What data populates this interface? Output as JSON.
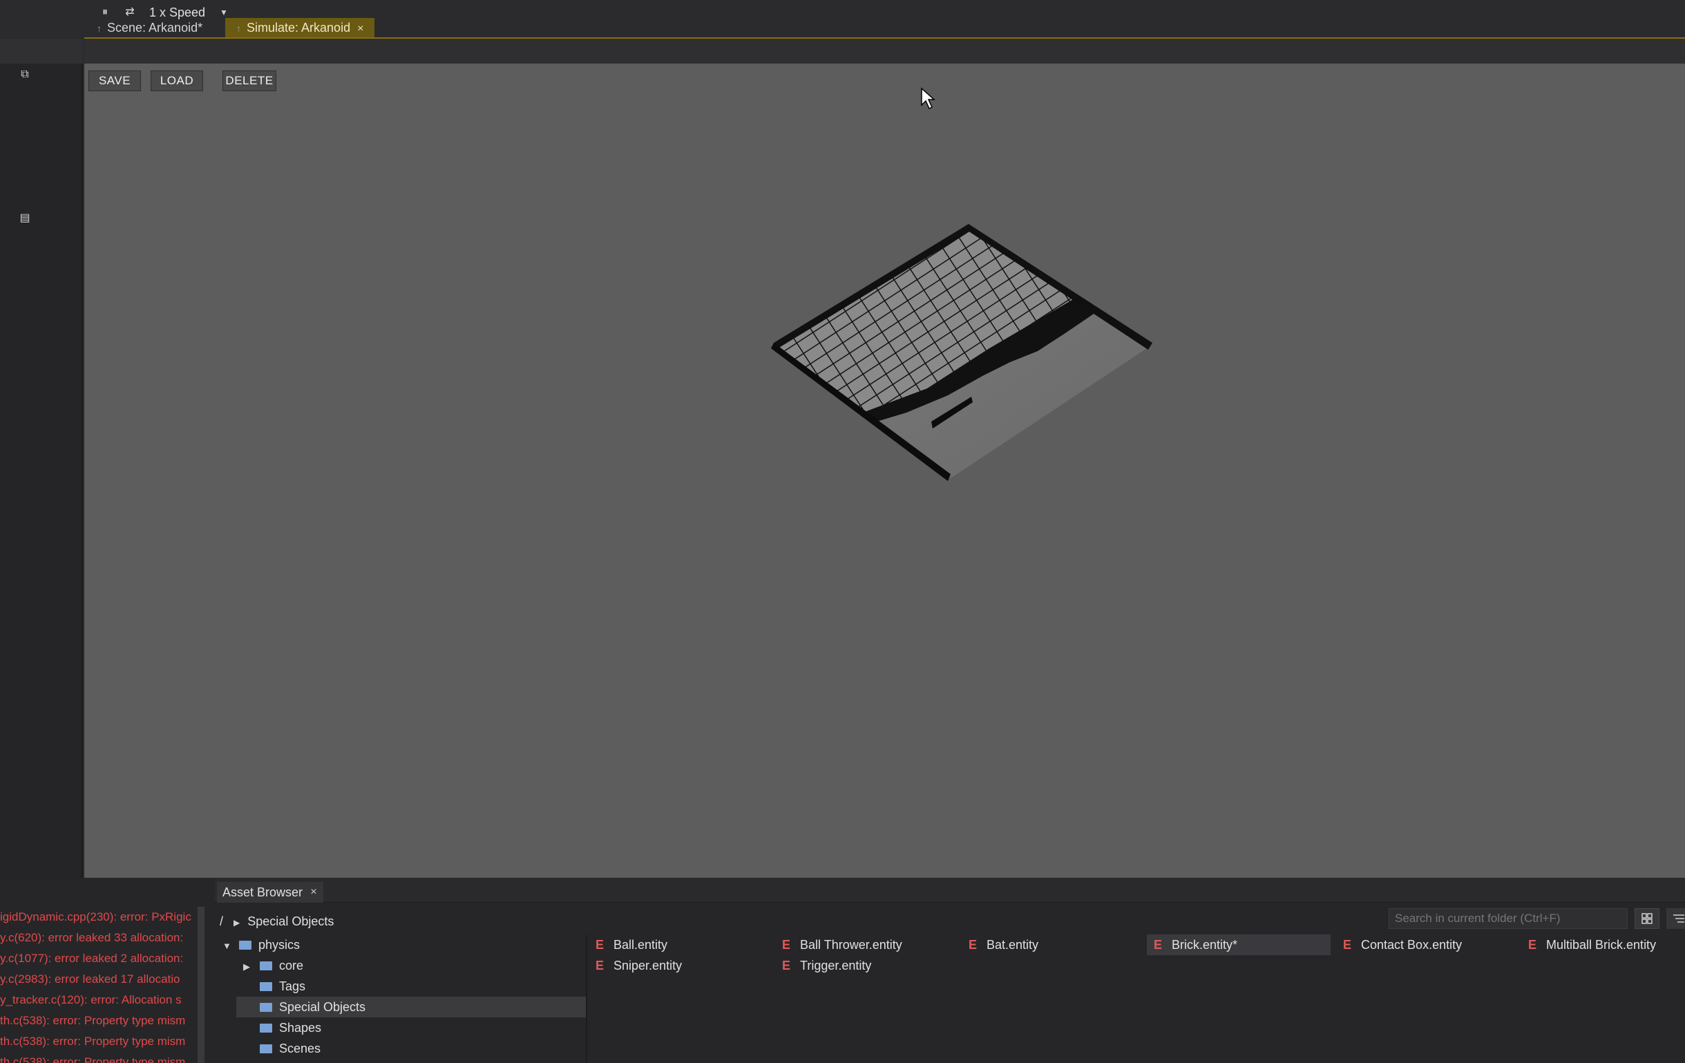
{
  "tabs": {
    "scene": "Scene: Arkanoid*",
    "simulate": "Simulate: Arkanoid",
    "close_glyph": "×"
  },
  "sim_toolbar": {
    "pause_glyph": "⏸",
    "loop_glyph": "⇄",
    "speed": "1 x Speed",
    "speed_caret": "▼"
  },
  "viewport_buttons": {
    "save": "SAVE",
    "load": "LOAD",
    "delete": "DELETE"
  },
  "console": {
    "lines": [
      "igidDynamic.cpp(230): error: PxRigic",
      "y.c(620): error leaked 33 allocation:",
      "y.c(1077): error leaked 2 allocation:",
      "y.c(2983): error leaked 17 allocatio",
      "y_tracker.c(120): error: Allocation s",
      "th.c(538): error: Property type mism",
      "th.c(538): error: Property type mism",
      "th.c(538): error: Property type mism"
    ],
    "color": "#e0494b"
  },
  "asset_browser": {
    "tab_label": "Asset Browser",
    "close_glyph": "×",
    "breadcrumb_root": "/",
    "breadcrumb_current": "Special Objects",
    "search_placeholder": "Search in current folder (Ctrl+F)",
    "tree": [
      {
        "label": "physics",
        "expanded": true
      },
      {
        "label": "core",
        "collapsed": true
      },
      {
        "label": "Tags"
      },
      {
        "label": "Special Objects",
        "selected": true
      },
      {
        "label": "Shapes"
      },
      {
        "label": "Scenes"
      }
    ],
    "files_row1": [
      "Ball.entity",
      "Ball Thrower.entity",
      "Bat.entity",
      "Brick.entity*",
      "Contact Box.entity",
      "Multiball Brick.entity"
    ],
    "files_row2": [
      "Sniper.entity",
      "Trigger.entity"
    ],
    "entity_icon": "E"
  },
  "colors": {
    "accent_tab": "#6b5a12",
    "viewport": "#5d5d5d",
    "folder": "#7aa2d8",
    "entity_icon": "#e05a5a"
  }
}
